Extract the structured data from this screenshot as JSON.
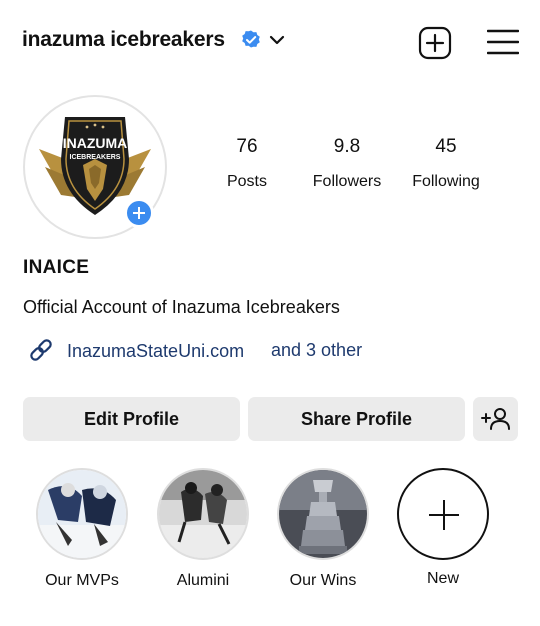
{
  "header": {
    "username": "inazuma icebreakers",
    "verified_icon": "verified-badge-icon",
    "dropdown_icon": "chevron-down-icon",
    "add_icon": "plus-square-icon",
    "menu_icon": "hamburger-menu-icon"
  },
  "profile": {
    "logo_text_top": "INAZUMA",
    "logo_text_bottom": "ICEBREAKERS",
    "stats": [
      {
        "value": "76",
        "label": "Posts"
      },
      {
        "value": "9.8",
        "label": "Followers"
      },
      {
        "value": "45",
        "label": "Following"
      }
    ],
    "display_name": "INAICE",
    "bio": "Official Account of Inazuma Icebreakers",
    "link": "InazumaStateUni.com",
    "link_more": "and 3 other"
  },
  "actions": {
    "edit_label": "Edit Profile",
    "share_label": "Share Profile",
    "add_user_icon": "add-person-icon"
  },
  "highlights": [
    {
      "label": "Our MVPs"
    },
    {
      "label": "Alumini"
    },
    {
      "label": "Our Wins"
    },
    {
      "label": "New"
    }
  ],
  "colors": {
    "accent_blue": "#3b8cf0",
    "link_text": "#1e3a6e",
    "button_bg": "#ebebeb",
    "logo_gold": "#b8913f",
    "logo_dark": "#1c1c1c"
  }
}
